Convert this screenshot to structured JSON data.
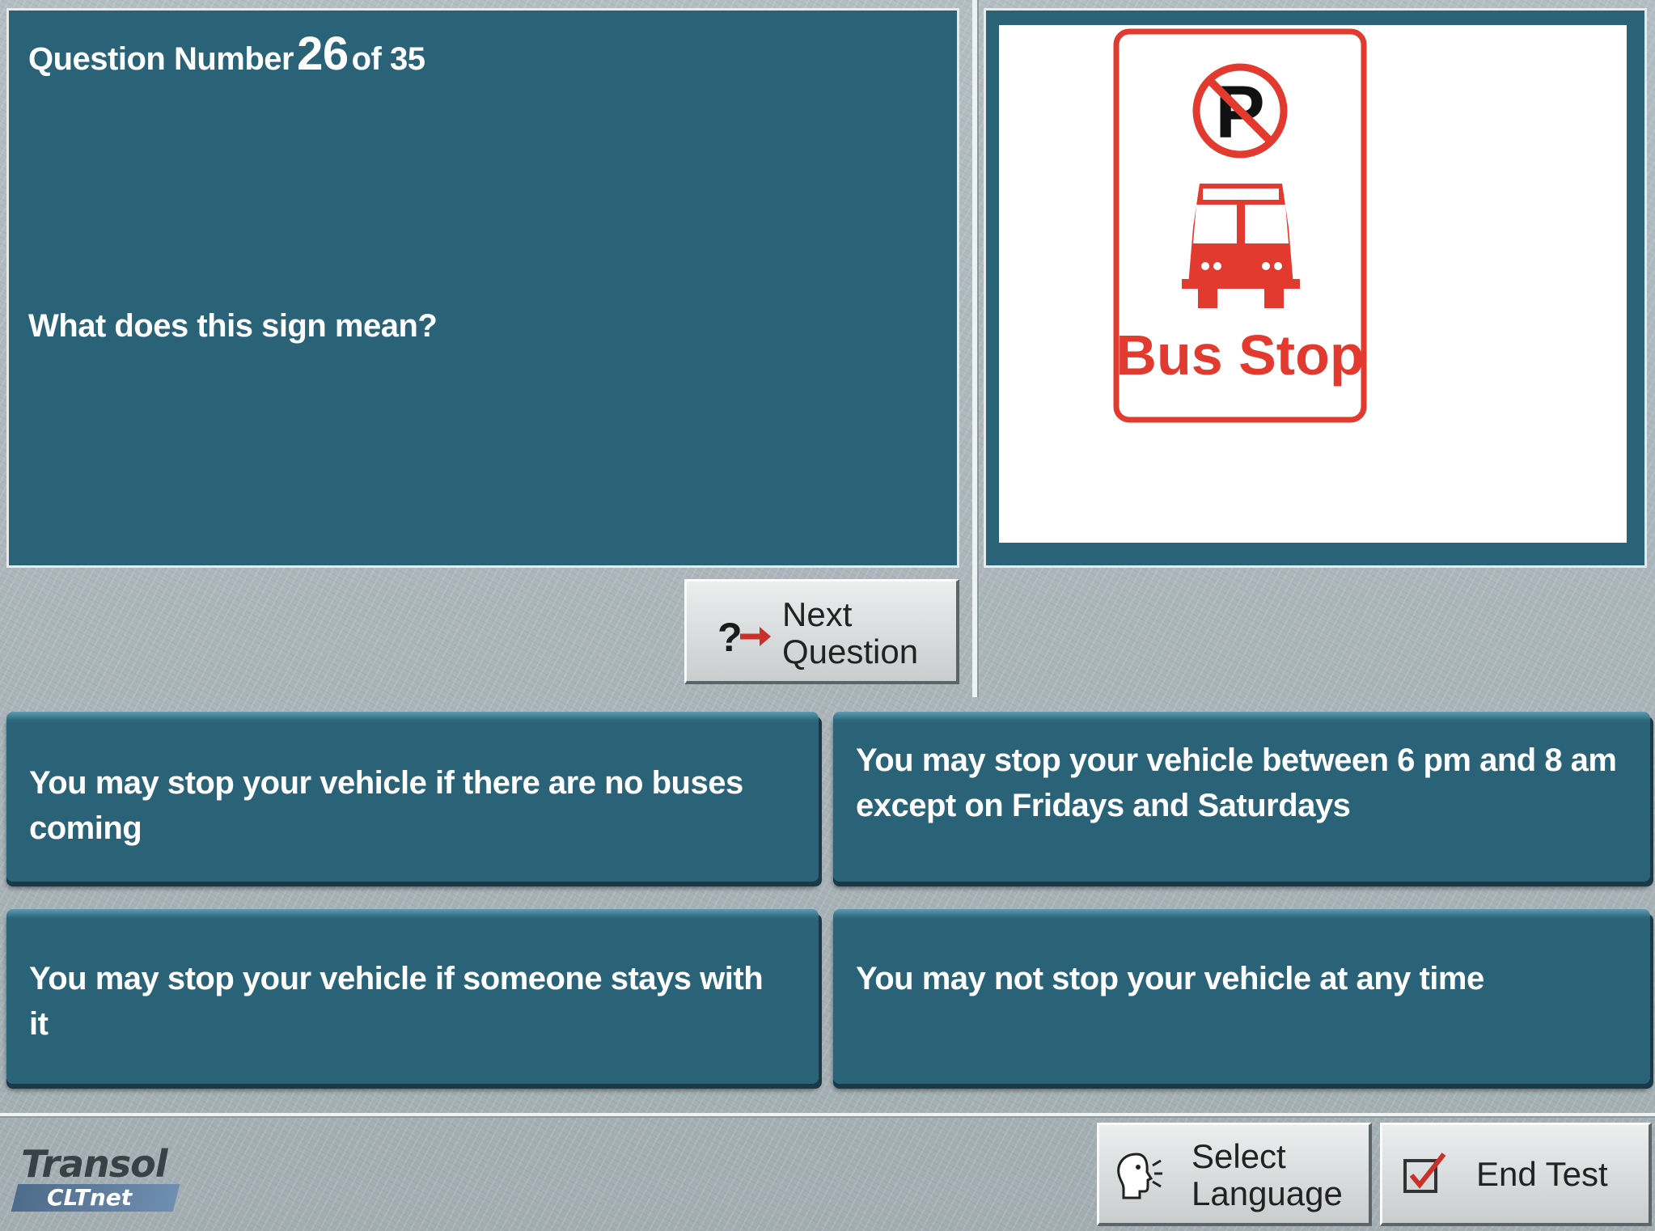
{
  "question": {
    "counter_prefix": "Question Number",
    "number": "26",
    "counter_suffix": "of 35",
    "text": "What does this sign mean?"
  },
  "sign": {
    "caption": "Bus Stop",
    "icons": [
      "no-parking-icon",
      "bus-icon"
    ],
    "accent_color": "#e23a2f"
  },
  "navigation": {
    "next_line1": "Next",
    "next_line2": "Question",
    "next_icon": "question-arrow-icon"
  },
  "answers": [
    {
      "text": "You may stop your vehicle if there are no buses coming"
    },
    {
      "text": "You may stop your vehicle between 6 pm and 8 am except on Fridays and Saturdays"
    },
    {
      "text": "You may stop your vehicle if someone stays with it"
    },
    {
      "text": "You may not stop your vehicle at any time"
    }
  ],
  "footer": {
    "logo_brand": "Transol",
    "logo_sub": "CLTnet",
    "select_language_line1": "Select",
    "select_language_line2": "Language",
    "select_language_icon": "speaking-head-icon",
    "end_test_label": "End Test",
    "end_test_icon": "checkbox-check-icon"
  },
  "colors": {
    "panel_teal": "#2a6378",
    "background_gray": "#aab5ba",
    "sign_red": "#e23a2f"
  }
}
